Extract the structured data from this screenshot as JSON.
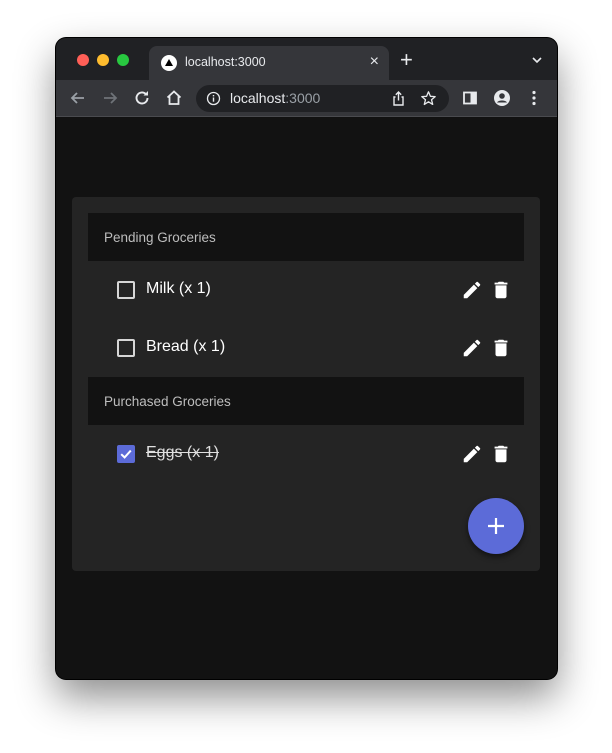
{
  "browser": {
    "tab_title": "localhost:3000",
    "tab_close": "×",
    "new_tab": "+",
    "url_host": "localhost",
    "url_port": ":3000"
  },
  "app": {
    "sections": [
      {
        "title": "Pending Groceries",
        "items": [
          {
            "label": "Milk (x 1)",
            "checked": false
          },
          {
            "label": "Bread (x 1)",
            "checked": false
          }
        ]
      },
      {
        "title": "Purchased Groceries",
        "items": [
          {
            "label": "Eggs (x 1)",
            "checked": true
          }
        ]
      }
    ],
    "accent_color": "#5c6bd8"
  },
  "icons": {
    "toolbar": [
      "back-icon",
      "forward-icon",
      "reload-icon",
      "home-icon",
      "info-icon",
      "share-icon",
      "star-icon",
      "sidebar-icon",
      "profile-icon",
      "more-icon"
    ],
    "item_actions": [
      "edit-icon",
      "delete-icon"
    ],
    "fab": "add-icon"
  }
}
